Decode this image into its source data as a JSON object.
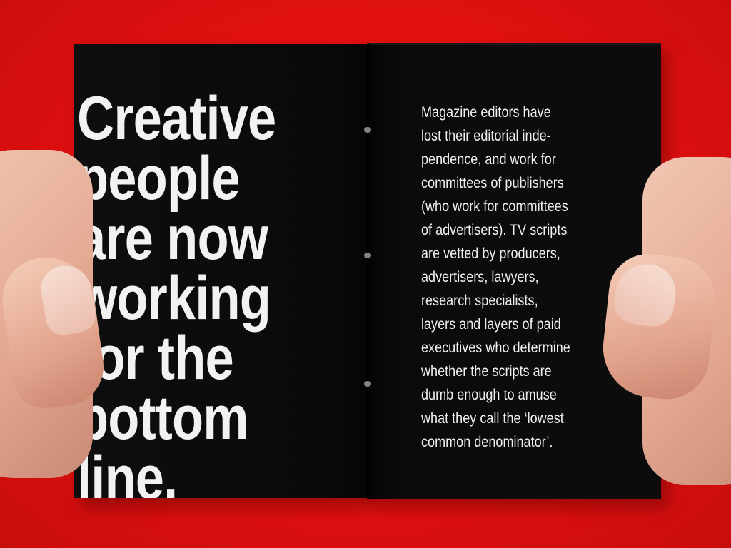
{
  "left_page": {
    "headline_lines": [
      "Creative",
      "people",
      "are now",
      "working",
      "for the",
      "bottom",
      "line."
    ]
  },
  "right_page": {
    "body_lines": [
      "Magazine editors have",
      "lost their editorial inde-",
      "pendence, and work for",
      "committees of publishers",
      "(who work for committees",
      "of advertisers). TV scripts",
      "are vetted by producers,",
      "advertisers, lawyers,",
      "research specialists,",
      "layers and layers of paid",
      "executives who determine",
      "whether the scripts are",
      "dumb enough to amuse",
      "what they call the ‘lowest",
      "common denominator’."
    ]
  },
  "colors": {
    "background": "#e8120f",
    "page": "#0b0b0b",
    "text": "#f2f2f2"
  }
}
